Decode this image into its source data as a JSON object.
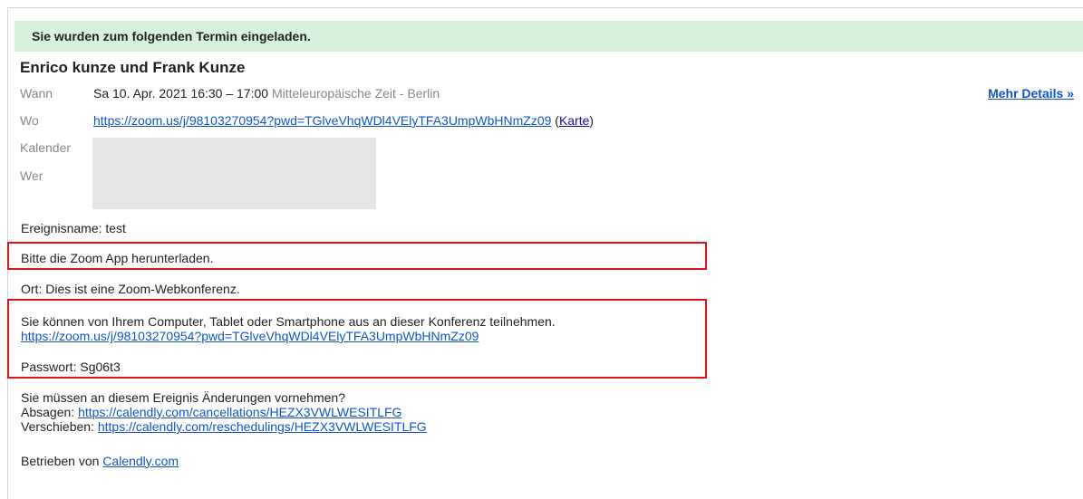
{
  "banner": {
    "text": "Sie wurden zum folgenden Termin eingeladen."
  },
  "event": {
    "title": "Enrico kunze und Frank Kunze",
    "when_label": "Wann",
    "when_value": "Sa 10. Apr. 2021 16:30 – 17:00",
    "when_tz": "Mitteleuropäische Zeit - Berlin",
    "where_label": "Wo",
    "where_link": "https://zoom.us/j/98103270954?pwd=TGlveVhqWDl4VElyTFA3UmpWbHNmZz09",
    "map_open": "(",
    "map_link": "Karte",
    "map_close": ")",
    "calendar_label": "Kalender",
    "who_label": "Wer",
    "more_details": "Mehr Details »"
  },
  "description": {
    "event_name": "Ereignisname: test",
    "download_note": "Bitte die Zoom App herunterladen.",
    "location": "Ort: Dies ist eine Zoom-Webkonferenz.",
    "join_text": "Sie können von Ihrem Computer, Tablet oder Smartphone aus an dieser Konferenz teilnehmen.",
    "join_link": "https://zoom.us/j/98103270954?pwd=TGlveVhqWDl4VElyTFA3UmpWbHNmZz09",
    "password": "Passwort: Sg06t3",
    "changes_question": "Sie müssen an diesem Ereignis Änderungen vornehmen?",
    "cancel_label": "Absagen: ",
    "cancel_link": "https://calendly.com/cancellations/HEZX3VWLWESITLFG",
    "reschedule_label": "Verschieben: ",
    "reschedule_link": "https://calendly.com/reschedulings/HEZX3VWLWESITLFG",
    "powered_label": "Betrieben von ",
    "powered_link": "Calendly.com"
  },
  "colors": {
    "banner_bg": "#d7f2dc",
    "link": "#1155cc",
    "highlight_box": "#e0121b"
  }
}
